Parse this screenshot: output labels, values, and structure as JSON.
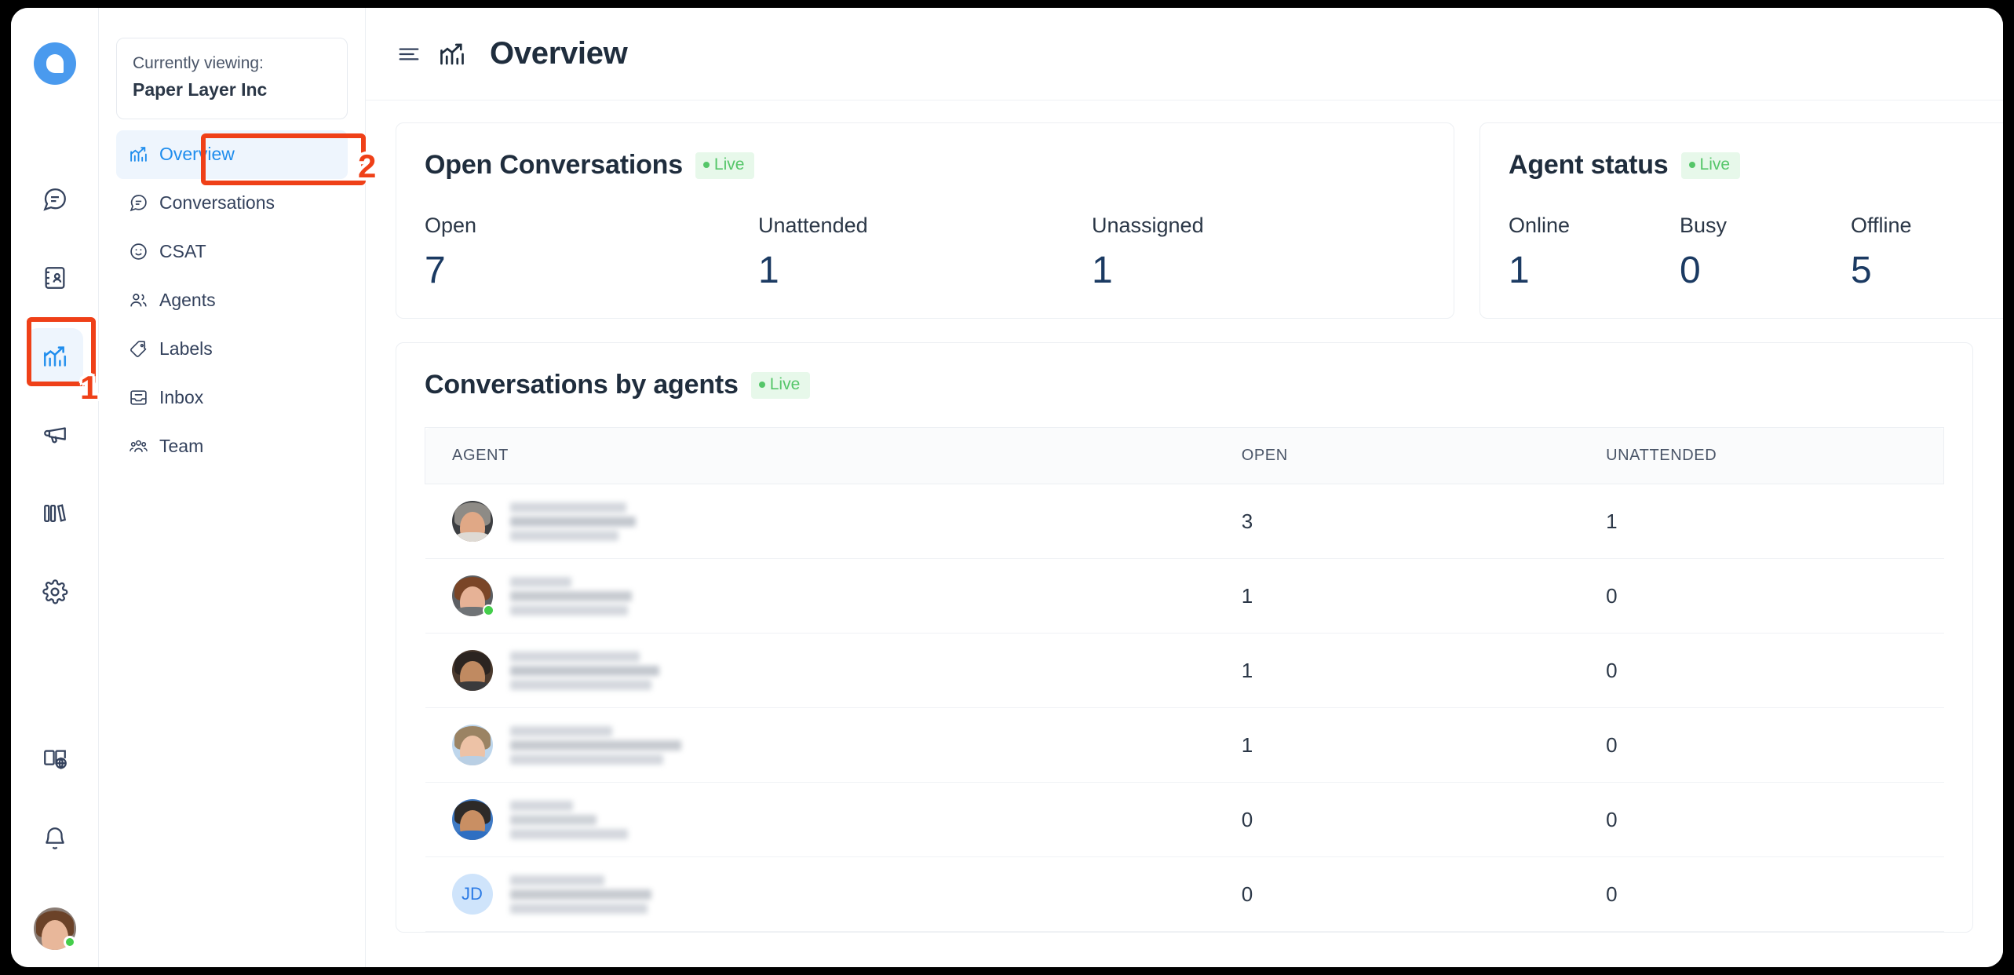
{
  "app": {
    "logo_name": "chatwoot-logo",
    "brand_color": "#4a9aee"
  },
  "rail": {
    "items": [
      {
        "name": "conversations",
        "icon": "chat-icon",
        "active": false
      },
      {
        "name": "contacts",
        "icon": "contacts-book-icon",
        "active": false
      },
      {
        "name": "reports",
        "icon": "reports-chart-icon",
        "active": true
      },
      {
        "name": "campaigns",
        "icon": "megaphone-icon",
        "active": false
      },
      {
        "name": "portals",
        "icon": "books-icon",
        "active": false
      },
      {
        "name": "settings",
        "icon": "gear-icon",
        "active": false
      }
    ],
    "bottom_items": [
      {
        "name": "help-center",
        "icon": "book-globe-icon"
      },
      {
        "name": "notifications",
        "icon": "bell-icon"
      }
    ],
    "avatar_name": "user-avatar"
  },
  "sidebar": {
    "viewing_label": "Currently viewing:",
    "account_name": "Paper Layer Inc",
    "items": [
      {
        "label": "Overview",
        "icon": "reports-chart-icon",
        "active": true
      },
      {
        "label": "Conversations",
        "icon": "chat-icon",
        "active": false
      },
      {
        "label": "CSAT",
        "icon": "smiley-icon",
        "active": false
      },
      {
        "label": "Agents",
        "icon": "people-icon",
        "active": false
      },
      {
        "label": "Labels",
        "icon": "tag-icon",
        "active": false
      },
      {
        "label": "Inbox",
        "icon": "inbox-icon",
        "active": false
      },
      {
        "label": "Team",
        "icon": "team-icon",
        "active": false
      }
    ]
  },
  "topbar": {
    "menu_icon": "hamburger-icon",
    "page_icon": "reports-chart-icon",
    "title": "Overview"
  },
  "open_conversations": {
    "title": "Open Conversations",
    "live_label": "Live",
    "metrics": [
      {
        "label": "Open",
        "value": "7"
      },
      {
        "label": "Unattended",
        "value": "1"
      },
      {
        "label": "Unassigned",
        "value": "1"
      }
    ]
  },
  "agent_status": {
    "title": "Agent status",
    "live_label": "Live",
    "metrics": [
      {
        "label": "Online",
        "value": "1"
      },
      {
        "label": "Busy",
        "value": "0"
      },
      {
        "label": "Offline",
        "value": "5"
      }
    ]
  },
  "conversations_by_agents": {
    "title": "Conversations by agents",
    "live_label": "Live",
    "columns": [
      "AGENT",
      "OPEN",
      "UNATTENDED"
    ],
    "rows": [
      {
        "agent_name": "",
        "avatar_type": "photo",
        "online": false,
        "open": "3",
        "unattended": "1"
      },
      {
        "agent_name": "",
        "avatar_type": "photo",
        "online": true,
        "open": "1",
        "unattended": "0"
      },
      {
        "agent_name": "",
        "avatar_type": "photo",
        "online": false,
        "open": "1",
        "unattended": "0"
      },
      {
        "agent_name": "",
        "avatar_type": "photo",
        "online": false,
        "open": "1",
        "unattended": "0"
      },
      {
        "agent_name": "",
        "avatar_type": "photo",
        "online": false,
        "open": "0",
        "unattended": "0"
      },
      {
        "agent_name": "JD",
        "avatar_type": "initials",
        "online": false,
        "open": "0",
        "unattended": "0"
      }
    ]
  },
  "annotations": {
    "step1": "1",
    "step2": "2",
    "color": "#ef4018"
  },
  "colors": {
    "accent_blue": "#1f8ded",
    "live_green": "#55c669",
    "value_navy": "#1b3a62",
    "text_dark": "#1f2d3d"
  }
}
